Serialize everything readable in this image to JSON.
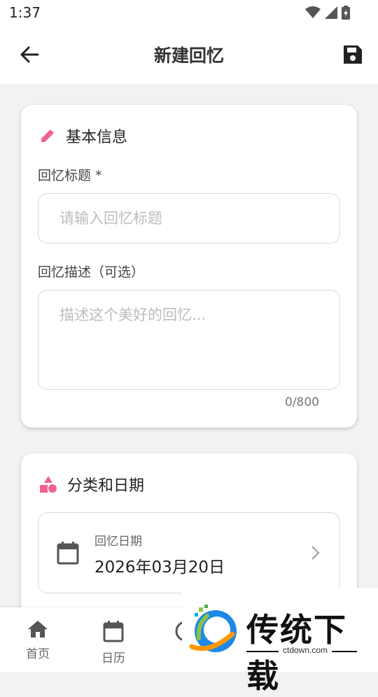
{
  "status_bar": {
    "time": "1:37"
  },
  "app_bar": {
    "title": "新建回忆"
  },
  "basic_info": {
    "section_title": "基本信息",
    "title_label": "回忆标题 *",
    "title_placeholder": "请输入回忆标题",
    "description_label": "回忆描述（可选）",
    "description_placeholder": "描述这个美好的回忆...",
    "char_counter": "0/800"
  },
  "category_date": {
    "section_title": "分类和日期",
    "date_label": "回忆日期",
    "date_value": "2026年03月20日"
  },
  "bottom_nav": {
    "items": [
      {
        "label": "首页",
        "icon": "home-icon"
      },
      {
        "label": "日历",
        "icon": "calendar-icon"
      },
      {
        "label": "",
        "icon": "partial-icon"
      }
    ]
  },
  "watermark": {
    "brand": "传统下载",
    "url": "ctdown.com"
  },
  "colors": {
    "accent": "#f06292",
    "text": "#222222",
    "border": "#d9d9d9"
  }
}
